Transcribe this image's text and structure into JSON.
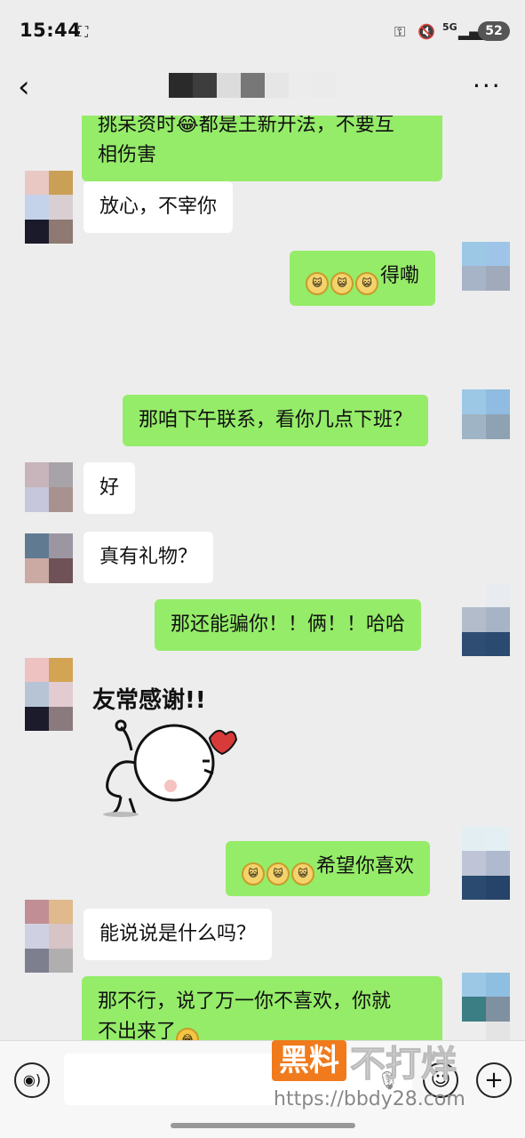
{
  "status_bar": {
    "time": "15:44",
    "network": "5G",
    "battery": "52"
  },
  "header": {
    "back_icon": "chevron-left-icon",
    "more_icon": "more-dots-icon"
  },
  "messages": [
    {
      "side": "out",
      "text_line1": "挑呆资时😂都是王新开法，不要互",
      "text_line2": "相伤害"
    },
    {
      "side": "in",
      "text": "放心，不宰你"
    },
    {
      "side": "out",
      "emojis": 3,
      "text": "得嘞"
    },
    {
      "side": "out",
      "text": "那咱下午联系，看你几点下班？"
    },
    {
      "side": "in",
      "text": "好"
    },
    {
      "side": "in",
      "text": "真有礼物？"
    },
    {
      "side": "out",
      "text": "那还能骗你！！俩！！哈哈"
    },
    {
      "side": "in",
      "sticker_text": "友常感谢!!"
    },
    {
      "side": "out",
      "emojis": 3,
      "text": "希望你喜欢"
    },
    {
      "side": "in",
      "text": "能说说是什么吗？"
    },
    {
      "side": "out",
      "text_line1": "那不行，说了万一你不喜欢，你就",
      "text_line2": "不出来了"
    }
  ],
  "input_bar": {
    "voice_icon": "voice-icon",
    "emoji_icon": "smile-icon",
    "plus_icon": "plus-icon",
    "placeholder": ""
  },
  "watermark": {
    "brand_box": "黑料",
    "brand_text": "不打烊",
    "url": "https://bbdy28.com"
  },
  "colors": {
    "background": "#ededed",
    "bubble_out": "#95ec69",
    "bubble_in": "#ffffff",
    "watermark_orange": "#f07a1c"
  }
}
